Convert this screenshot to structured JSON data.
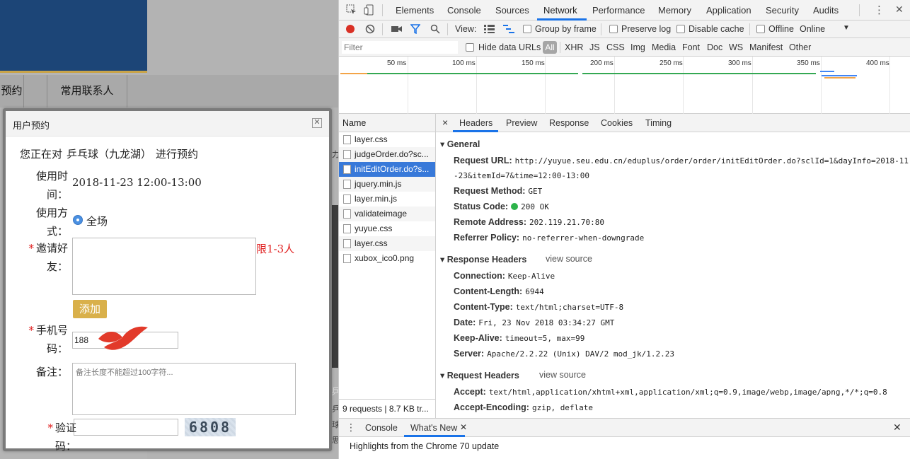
{
  "left_page": {
    "nav_tabs": [
      "预约",
      "常用联系人"
    ],
    "bg_fragments": [
      "力",
      "乒",
      "乒",
      "球",
      "思"
    ]
  },
  "dialog": {
    "title": "用户预约",
    "close_glyph": "✕",
    "intro_prefix": "您正在对",
    "intro_venue": "乒乓球（九龙湖）",
    "intro_suffix": "进行预约",
    "time_label_1": "使用时",
    "time_label_2": "间：",
    "time_value": "2018-11-23 12:00-13:00",
    "mode_label_1": "使用方",
    "mode_label_2": "式：",
    "mode_option": "全场",
    "friends_label_1": "邀请好",
    "friends_label_2": "友：",
    "friends_hint": "限1-3人",
    "add_button": "添加",
    "phone_label_1": "手机号",
    "phone_label_2": "码：",
    "phone_value": "188",
    "note_label": "备注：",
    "note_placeholder": "备注长度不能超过100字符...",
    "captcha_label_1": "验证",
    "captcha_label_2": "码：",
    "captcha_code": "6808",
    "required_mark": "*"
  },
  "devtools": {
    "tabs": [
      "Elements",
      "Console",
      "Sources",
      "Network",
      "Performance",
      "Memory",
      "Application",
      "Security",
      "Audits"
    ],
    "active_tab": "Network",
    "toolbar": {
      "view_label": "View:",
      "group_by_frame": "Group by frame",
      "preserve_log": "Preserve log",
      "disable_cache": "Disable cache",
      "offline": "Offline",
      "throttle": "Online"
    },
    "filter": {
      "placeholder": "Filter",
      "hide_data_urls": "Hide data URLs",
      "types": [
        "All",
        "XHR",
        "JS",
        "CSS",
        "Img",
        "Media",
        "Font",
        "Doc",
        "WS",
        "Manifest",
        "Other"
      ]
    },
    "timeline_ticks": [
      "50 ms",
      "100 ms",
      "150 ms",
      "200 ms",
      "250 ms",
      "300 ms",
      "350 ms",
      "400 ms"
    ],
    "requests_header": "Name",
    "requests": [
      "layer.css",
      "judgeOrder.do?sc...",
      "initEditOrder.do?s...",
      "jquery.min.js",
      "layer.min.js",
      "validateimage",
      "yuyue.css",
      "layer.css",
      "xubox_ico0.png"
    ],
    "selected_request_index": 2,
    "status_summary": "9 requests | 8.7 KB tr...",
    "detail_tabs": [
      "Headers",
      "Preview",
      "Response",
      "Cookies",
      "Timing"
    ],
    "detail_close": "×",
    "general": {
      "title": "General",
      "request_url_key": "Request URL:",
      "request_url_1": "http://yuyue.seu.edu.cn/eduplus/order/order/initEditOrder.do?sclId=1&dayInfo=2018-11",
      "request_url_2": "-23&itemId=7&time=12:00-13:00",
      "request_method_key": "Request Method:",
      "request_method": "GET",
      "status_code_key": "Status Code:",
      "status_code": "200 OK",
      "remote_address_key": "Remote Address:",
      "remote_address": "202.119.21.70:80",
      "referrer_policy_key": "Referrer Policy:",
      "referrer_policy": "no-referrer-when-downgrade"
    },
    "response_headers": {
      "title": "Response Headers",
      "view_source": "view source",
      "rows": [
        {
          "k": "Connection:",
          "v": "Keep-Alive"
        },
        {
          "k": "Content-Length:",
          "v": "6944"
        },
        {
          "k": "Content-Type:",
          "v": "text/html;charset=UTF-8"
        },
        {
          "k": "Date:",
          "v": "Fri, 23 Nov 2018 03:34:27 GMT"
        },
        {
          "k": "Keep-Alive:",
          "v": "timeout=5, max=99"
        },
        {
          "k": "Server:",
          "v": "Apache/2.2.22 (Unix) DAV/2 mod_jk/1.2.23"
        }
      ]
    },
    "request_headers": {
      "title": "Request Headers",
      "view_source": "view source",
      "rows": [
        {
          "k": "Accept:",
          "v": "text/html,application/xhtml+xml,application/xml;q=0.9,image/webp,image/apng,*/*;q=0.8"
        },
        {
          "k": "Accept-Encoding:",
          "v": "gzip, deflate"
        }
      ]
    },
    "drawer": {
      "tabs": [
        "Console",
        "What's New"
      ],
      "message": "Highlights from the Chrome 70 update"
    }
  }
}
